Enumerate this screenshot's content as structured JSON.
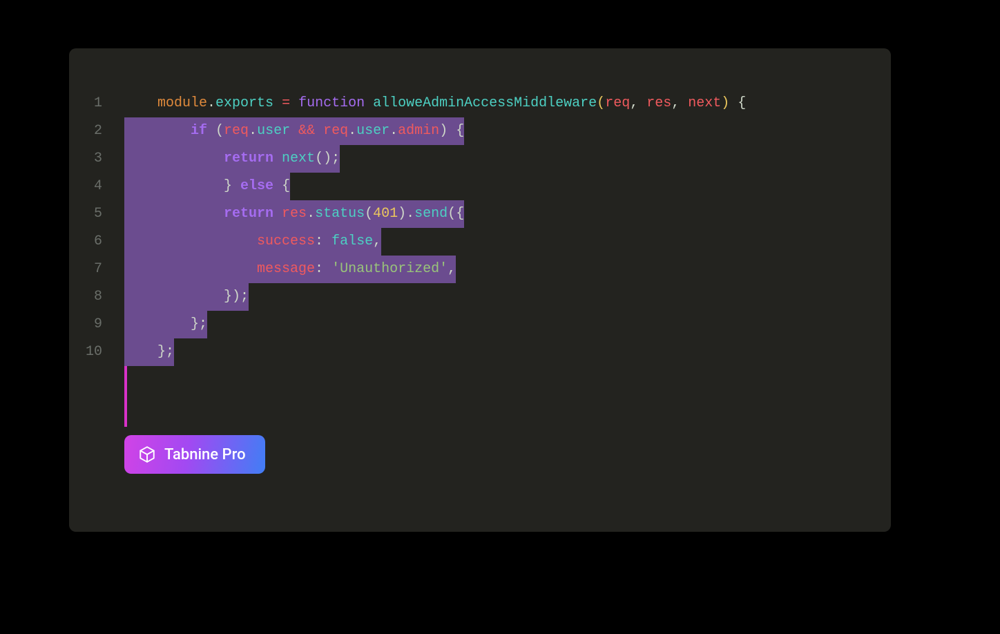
{
  "editor": {
    "badge_label": "Tabnine Pro",
    "lines": [
      {
        "num": "1",
        "highlight": false,
        "indent": "    ",
        "tokens": [
          {
            "t": "module",
            "c": "t-orange"
          },
          {
            "t": ".",
            "c": "t-pale"
          },
          {
            "t": "exports",
            "c": "t-cyan"
          },
          {
            "t": " = ",
            "c": "t-red"
          },
          {
            "t": "function ",
            "c": "t-purple"
          },
          {
            "t": "alloweAdminAccessMiddleware",
            "c": "t-cyan"
          },
          {
            "t": "(",
            "c": "t-yellow"
          },
          {
            "t": "req",
            "c": "t-red"
          },
          {
            "t": ", ",
            "c": "t-pale"
          },
          {
            "t": "res",
            "c": "t-red"
          },
          {
            "t": ", ",
            "c": "t-pale"
          },
          {
            "t": "next",
            "c": "t-red"
          },
          {
            "t": ")",
            "c": "t-yellow"
          },
          {
            "t": " {",
            "c": "t-pale"
          }
        ]
      },
      {
        "num": "2",
        "highlight": true,
        "indent": "        ",
        "tokens": [
          {
            "t": "if ",
            "c": "t-purple bold"
          },
          {
            "t": "(",
            "c": "t-pale"
          },
          {
            "t": "req",
            "c": "t-red"
          },
          {
            "t": ".",
            "c": "t-pale"
          },
          {
            "t": "user",
            "c": "t-cyan"
          },
          {
            "t": " && ",
            "c": "t-red"
          },
          {
            "t": "req",
            "c": "t-red"
          },
          {
            "t": ".",
            "c": "t-pale"
          },
          {
            "t": "user",
            "c": "t-cyan"
          },
          {
            "t": ".",
            "c": "t-pale"
          },
          {
            "t": "admin",
            "c": "t-red"
          },
          {
            "t": ")",
            "c": "t-pale"
          },
          {
            "t": " {",
            "c": "t-pale"
          }
        ]
      },
      {
        "num": "3",
        "highlight": true,
        "indent": "            ",
        "tokens": [
          {
            "t": "return ",
            "c": "t-purple bold"
          },
          {
            "t": "next",
            "c": "t-cyan"
          },
          {
            "t": "()",
            "c": "t-pale"
          },
          {
            "t": ";",
            "c": "t-pale"
          }
        ]
      },
      {
        "num": "4",
        "highlight": true,
        "indent": "            ",
        "tokens": [
          {
            "t": "}",
            "c": "t-pale"
          },
          {
            "t": " else ",
            "c": "t-purple bold"
          },
          {
            "t": "{",
            "c": "t-pale"
          }
        ]
      },
      {
        "num": "5",
        "highlight": true,
        "indent": "            ",
        "tokens": [
          {
            "t": "return ",
            "c": "t-purple bold"
          },
          {
            "t": "res",
            "c": "t-red"
          },
          {
            "t": ".",
            "c": "t-pale"
          },
          {
            "t": "status",
            "c": "t-cyan"
          },
          {
            "t": "(",
            "c": "t-pale"
          },
          {
            "t": "401",
            "c": "t-yellow"
          },
          {
            "t": ")",
            "c": "t-pale"
          },
          {
            "t": ".",
            "c": "t-pale"
          },
          {
            "t": "send",
            "c": "t-cyan"
          },
          {
            "t": "(",
            "c": "t-pale"
          },
          {
            "t": "{",
            "c": "t-pale"
          }
        ]
      },
      {
        "num": "6",
        "highlight": true,
        "indent": "                ",
        "tokens": [
          {
            "t": "success",
            "c": "t-red"
          },
          {
            "t": ": ",
            "c": "t-pale"
          },
          {
            "t": "false",
            "c": "t-cyan"
          },
          {
            "t": ",",
            "c": "t-pale"
          }
        ]
      },
      {
        "num": "7",
        "highlight": true,
        "indent": "                ",
        "tokens": [
          {
            "t": "message",
            "c": "t-red"
          },
          {
            "t": ": ",
            "c": "t-pale"
          },
          {
            "t": "'Unauthorized'",
            "c": "t-green"
          },
          {
            "t": ",",
            "c": "t-pale"
          }
        ]
      },
      {
        "num": "8",
        "highlight": true,
        "indent": "            ",
        "tokens": [
          {
            "t": "})",
            "c": "t-pale"
          },
          {
            "t": ";",
            "c": "t-pale"
          }
        ]
      },
      {
        "num": "9",
        "highlight": true,
        "indent": "        ",
        "tokens": [
          {
            "t": "}",
            "c": "t-pale"
          },
          {
            "t": ";",
            "c": "t-pale"
          }
        ]
      },
      {
        "num": "10",
        "highlight": true,
        "indent": "    ",
        "tokens": [
          {
            "t": "}",
            "c": "t-pale"
          },
          {
            "t": ";",
            "c": "t-pale"
          }
        ]
      }
    ]
  }
}
